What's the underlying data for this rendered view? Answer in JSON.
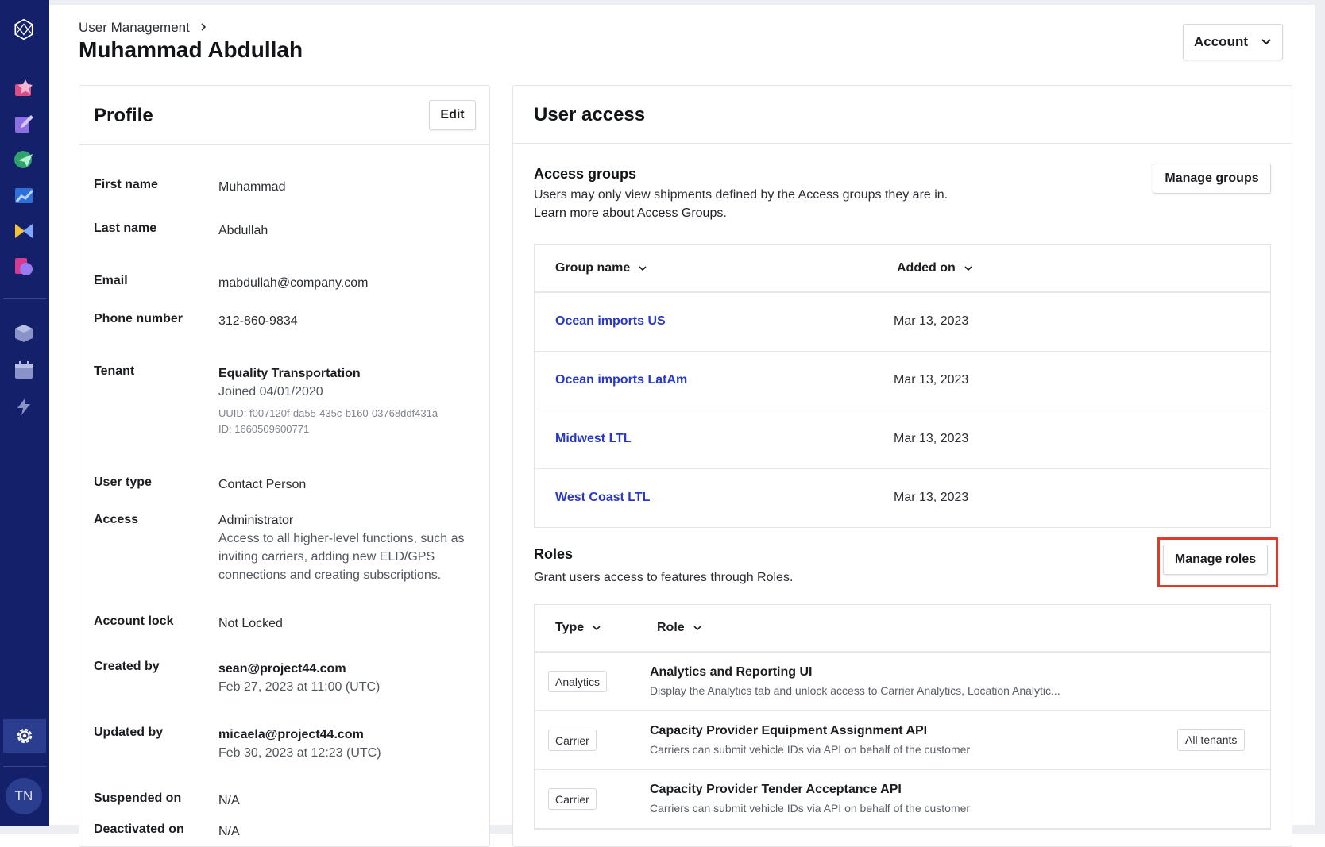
{
  "header": {
    "breadcrumb": "User Management",
    "title": "Muhammad Abdullah",
    "account_label": "Account"
  },
  "sidebar": {
    "avatar_initials": "TN",
    "icons": [
      "home-icon",
      "pencil-icon",
      "send-icon",
      "chart-icon",
      "flag-icon",
      "document-icon",
      "box-icon",
      "calendar-icon",
      "lightning-icon",
      "settings-icon"
    ]
  },
  "profile": {
    "title": "Profile",
    "edit_label": "Edit",
    "fields": {
      "first_name": {
        "label": "First name",
        "value": "Muhammad"
      },
      "last_name": {
        "label": "Last name",
        "value": "Abdullah"
      },
      "email": {
        "label": "Email",
        "value": "mabdullah@company.com"
      },
      "phone": {
        "label": "Phone number",
        "value": "312-860-9834"
      },
      "tenant": {
        "label": "Tenant",
        "name": "Equality Transportation",
        "joined": "Joined 04/01/2020",
        "uuid": "UUID: f007120f-da55-435c-b160-03768ddf431a",
        "id": "ID: 1660509600771"
      },
      "user_type": {
        "label": "User type",
        "value": "Contact Person"
      },
      "access": {
        "label": "Access",
        "value": "Administrator",
        "description": "Access to all higher-level functions, such as inviting carriers, adding new ELD/GPS connections and creating subscriptions."
      },
      "account_lock": {
        "label": "Account lock",
        "value": "Not Locked"
      },
      "created_by": {
        "label": "Created by",
        "value": "sean@project44.com",
        "date": "Feb 27, 2023 at 11:00 (UTC)"
      },
      "updated_by": {
        "label": "Updated by",
        "value": "micaela@project44.com",
        "date": "Feb 30, 2023 at 12:23 (UTC)"
      },
      "suspended_on": {
        "label": "Suspended on",
        "value": "N/A"
      },
      "deactivated_on": {
        "label": "Deactivated on",
        "value": "N/A"
      }
    }
  },
  "access": {
    "title": "User access",
    "groups": {
      "title": "Access groups",
      "description": "Users may only view shipments defined by the Access groups they are in.",
      "learn_more": "Learn more about Access Groups",
      "learn_more_suffix": ".",
      "manage_label": "Manage groups",
      "columns": [
        "Group name",
        "Added on"
      ],
      "rows": [
        {
          "name": "Ocean imports US",
          "added": "Mar 13, 2023"
        },
        {
          "name": "Ocean imports LatAm",
          "added": "Mar 13, 2023"
        },
        {
          "name": "Midwest LTL",
          "added": "Mar 13, 2023"
        },
        {
          "name": "West Coast LTL",
          "added": "Mar 13, 2023"
        }
      ]
    },
    "roles": {
      "title": "Roles",
      "description": "Grant users access to features through Roles.",
      "manage_label": "Manage roles",
      "columns": [
        "Type",
        "Role"
      ],
      "rows": [
        {
          "type": "Analytics",
          "name": "Analytics and Reporting UI",
          "description": "Display the Analytics tab and unlock access to Carrier Analytics, Location Analytic...",
          "scope": ""
        },
        {
          "type": "Carrier",
          "name": "Capacity Provider Equipment Assignment API",
          "description": "Carriers can submit vehicle IDs via API on behalf of the customer",
          "scope": "All tenants"
        },
        {
          "type": "Carrier",
          "name": "Capacity Provider Tender Acceptance API",
          "description": "Carriers can submit vehicle IDs via API on behalf of the customer",
          "scope": ""
        }
      ]
    }
  },
  "colors": {
    "sidebar": "#15206a",
    "link": "#2838c9",
    "highlight": "#e03a2b"
  }
}
